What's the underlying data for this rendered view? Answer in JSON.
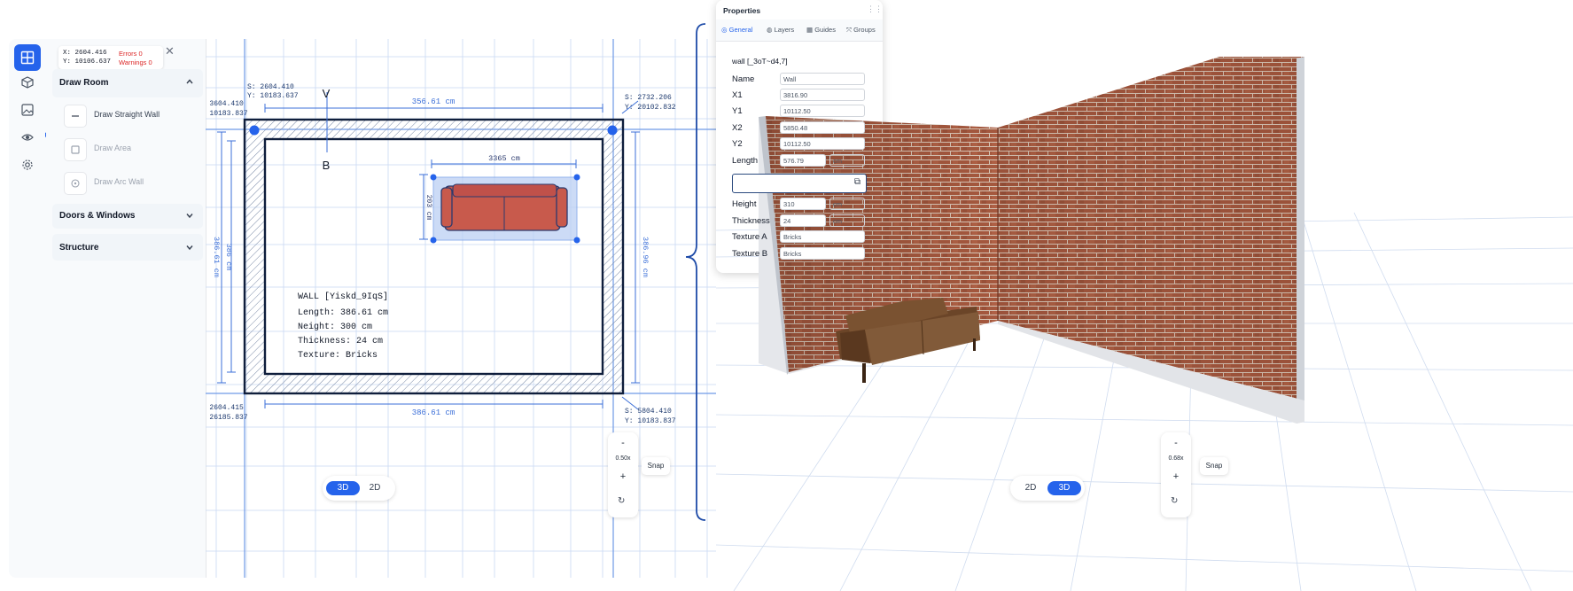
{
  "editor2d": {
    "coord_readout": {
      "x_label": "X: 2604.416",
      "y_label": "Y: 10106.637",
      "errors": "Errors 0",
      "warnings": "Warnings 0"
    },
    "sidebar": {
      "draw_room": {
        "title": "Draw Room",
        "tools": [
          {
            "label": "Draw Straight Wall",
            "icon": "line-icon",
            "disabled": false
          },
          {
            "label": "Draw Area",
            "icon": "square-icon",
            "disabled": true
          },
          {
            "label": "Draw Arc Wall",
            "icon": "arc-icon",
            "disabled": true
          }
        ]
      },
      "doors_windows": {
        "title": "Doors & Windows"
      },
      "structure": {
        "title": "Structure"
      }
    },
    "canvas": {
      "corner_labels": {
        "top_left_inner": [
          "S: 2604.410",
          "Y: 10183.637"
        ],
        "top_left_outer": [
          "S: 3604.410",
          "Y: 10183.837"
        ],
        "top_right": [
          "S: 2732.206",
          "Y: 20102.832"
        ],
        "bottom_left": [
          "Z: 2604.415",
          "Y: 26185.837"
        ],
        "bottom_right": [
          "S: 5804.410",
          "Y: 10183.837"
        ]
      },
      "dim_top": "356.61 cm",
      "dim_bottom": "386.61 cm",
      "dim_left_outer": "386.61 cm",
      "dim_left_inner": "386 cm",
      "dim_right": "386.96 cm",
      "section_top": "V",
      "section_bottom": "B",
      "sofa_width": "3365 cm",
      "sofa_depth": "203 cm",
      "wall_info": {
        "title": "WALL [Yiskd_9IqS]",
        "length": "Length: 386.61 cm",
        "height": "Neight: 300 cm",
        "thickness": "Thickness: 24 cm",
        "texture": "Texture: Bricks"
      },
      "view_toggle": {
        "active": "3D",
        "inactive": "2D"
      },
      "zoom": {
        "minus": "-",
        "level": "0.50x",
        "plus": "+"
      },
      "snap_label": "Snap"
    }
  },
  "view3d": {
    "view_toggle": {
      "inactive": "2D",
      "active": "3D"
    },
    "zoom": {
      "minus": "-",
      "level": "0.68x",
      "plus": "+"
    },
    "snap_label": "Snap",
    "properties": {
      "title": "Properties",
      "tabs": [
        {
          "label": "General",
          "icon": "settings-icon"
        },
        {
          "label": "Layers",
          "icon": "layers-icon"
        },
        {
          "label": "Guides",
          "icon": "grid-icon"
        },
        {
          "label": "Groups",
          "icon": "group-icon"
        }
      ],
      "object_id": "wall [_3oT~d4,7]",
      "fields": [
        {
          "label": "Name",
          "value": "Wall"
        },
        {
          "label": "X1",
          "value": "3816.90"
        },
        {
          "label": "Y1",
          "value": "10112.50"
        },
        {
          "label": "X2",
          "value": "5850.48"
        },
        {
          "label": "Y2",
          "value": "10112.50"
        },
        {
          "label": "Length",
          "value": "576.79",
          "unit": "cm"
        }
      ],
      "fields2": [
        {
          "label": "Height",
          "value": "310",
          "unit": "cm"
        },
        {
          "label": "Thickness",
          "value": "24",
          "unit": "cm"
        },
        {
          "label": "Texture A",
          "value": "Bricks"
        },
        {
          "label": "Texture B",
          "value": "Bricks"
        }
      ]
    }
  },
  "colors": {
    "accent": "#2563eb",
    "wall_outline": "#0f1e3c",
    "dim_line": "#3b6fd8",
    "grid": "#c8d8f3",
    "brick": "#a5583e",
    "sofa_3d": "#6b4528",
    "sofa_2d": "#c85a4c"
  }
}
